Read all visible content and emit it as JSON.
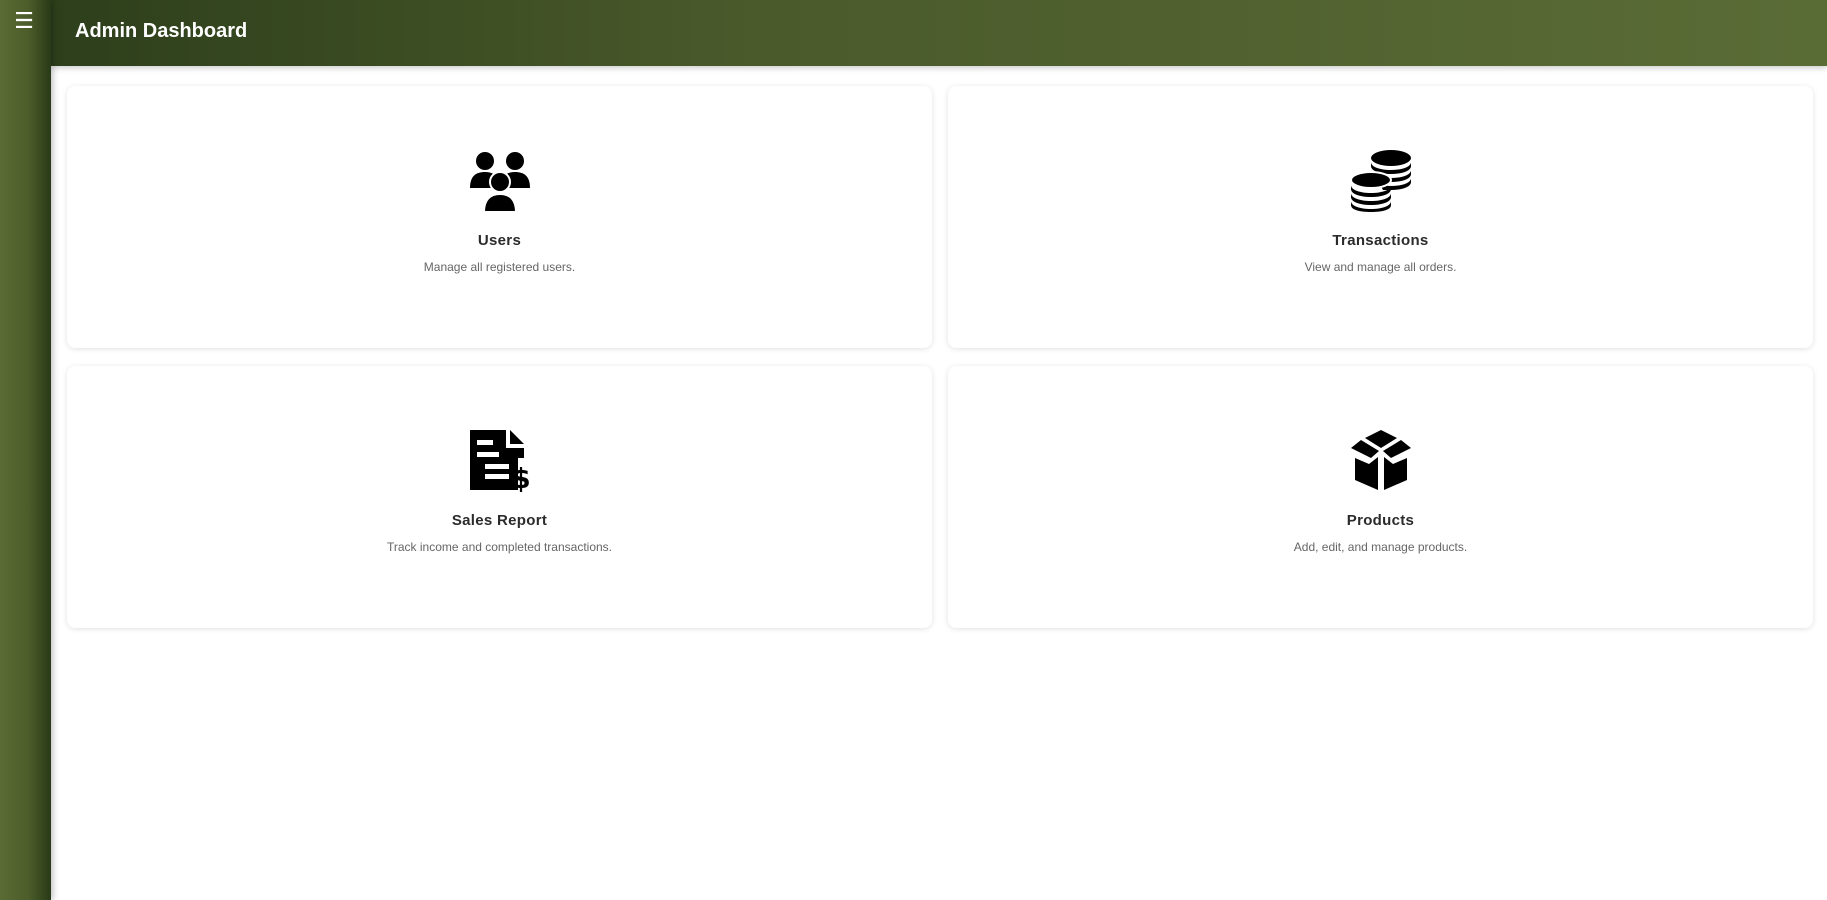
{
  "sidebar": {
    "menu_icon": "☰"
  },
  "header": {
    "title": "Admin Dashboard"
  },
  "cards": [
    {
      "icon": "users-icon",
      "title": "Users",
      "description": "Manage all registered users."
    },
    {
      "icon": "coins-icon",
      "title": "Transactions",
      "description": "View and manage all orders."
    },
    {
      "icon": "invoice-dollar-icon",
      "title": "Sales Report",
      "description": "Track income and completed transactions."
    },
    {
      "icon": "box-icon",
      "title": "Products",
      "description": "Add, edit, and manage products."
    }
  ],
  "colors": {
    "sidebar_dark": "#283a17",
    "sidebar_light": "#5b6b34",
    "header_start": "#2d3f1b",
    "header_end": "#5a6c36",
    "card_title": "#2b2b2b",
    "card_desc": "#666666"
  }
}
